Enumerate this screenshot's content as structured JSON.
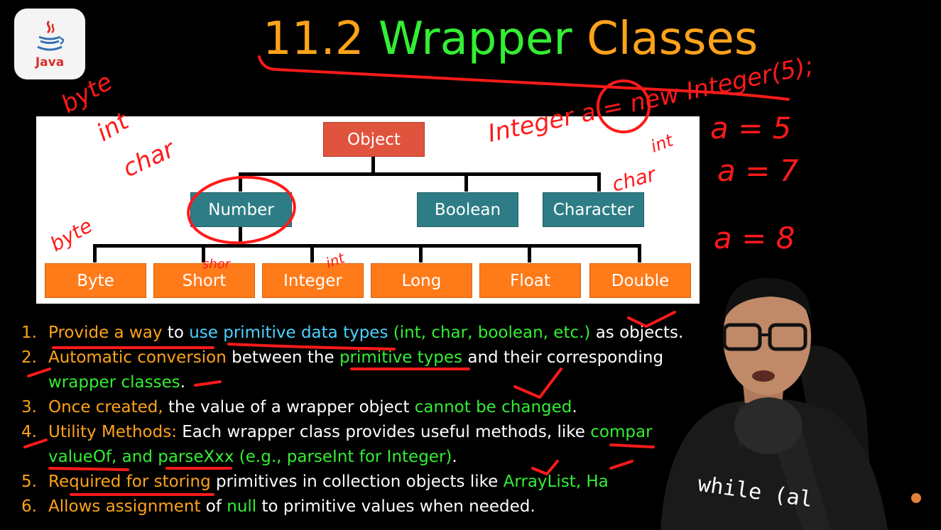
{
  "logo": {
    "icon": "java-cup-icon",
    "text": "Java"
  },
  "title": {
    "number": "11.2",
    "word1": "Wrapper",
    "word2": "Classes"
  },
  "diagram": {
    "root": "Object",
    "level2": [
      "Number",
      "Boolean",
      "Character"
    ],
    "level3": [
      "Byte",
      "Short",
      "Integer",
      "Long",
      "Float",
      "Double"
    ]
  },
  "points": [
    {
      "num": "1.",
      "parts": [
        "Provide a way",
        " to ",
        "use primitive data types",
        " (int, char, boolean, etc.)",
        " as objects."
      ]
    },
    {
      "num": "2.",
      "parts": [
        "Automatic conversion",
        " between the ",
        "primitive types",
        " and their corresponding"
      ],
      "cont": [
        "wrapper classes",
        "."
      ]
    },
    {
      "num": "3.",
      "parts": [
        "Once created,",
        " the value of a wrapper object ",
        "cannot be changed",
        "."
      ]
    },
    {
      "num": "4.",
      "parts": [
        "Utility Methods:",
        " Each wrapper class provides useful methods, like ",
        "compar"
      ],
      "cont": [
        "valueOf, and parseXxx (e.g., parseInt for Integer)",
        "."
      ]
    },
    {
      "num": "5.",
      "parts": [
        "Required for storing",
        " primitives in collection objects like ",
        "ArrayList, Ha"
      ]
    },
    {
      "num": "6.",
      "parts": [
        "Allows assignment",
        " of ",
        "null",
        " to primitive values when needed."
      ]
    }
  ],
  "annotations": {
    "top_left": [
      "byte",
      "int",
      "char"
    ],
    "code": "Integer a = new Integer(5);",
    "values": [
      "a = 5",
      "a = 7",
      "a = 8"
    ],
    "int_label": "int",
    "char_label": "char",
    "byte_label": "byte",
    "short_label": "shor",
    "int_small": "int"
  },
  "presenter": {
    "shirt_text": "while (al"
  },
  "colors": {
    "orange": "#ffa31a",
    "green": "#33ee33",
    "blue": "#4dd2ff",
    "ink": "#ff1a1a"
  }
}
